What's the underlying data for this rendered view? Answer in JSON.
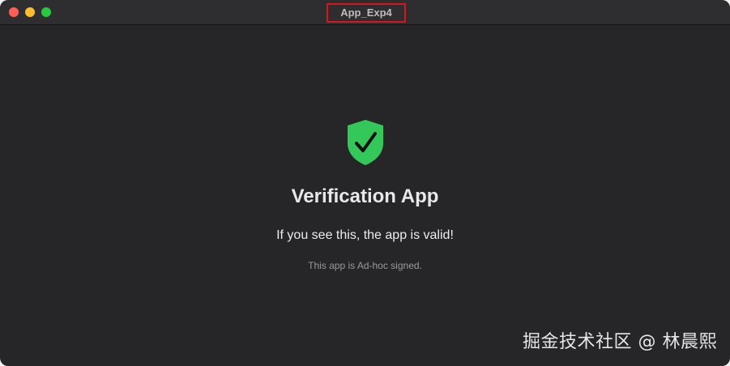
{
  "window": {
    "title": "App_Exp4"
  },
  "main": {
    "icon": "shield-check-icon",
    "heading": "Verification App",
    "subtitle": "If you see this, the app is valid!",
    "note": "This app is Ad-hoc signed."
  },
  "watermark": {
    "text": "掘金技术社区 @ 林晨熙"
  },
  "colors": {
    "background": "#262628",
    "shield": "#34c759",
    "highlight_box": "#d9151b"
  }
}
